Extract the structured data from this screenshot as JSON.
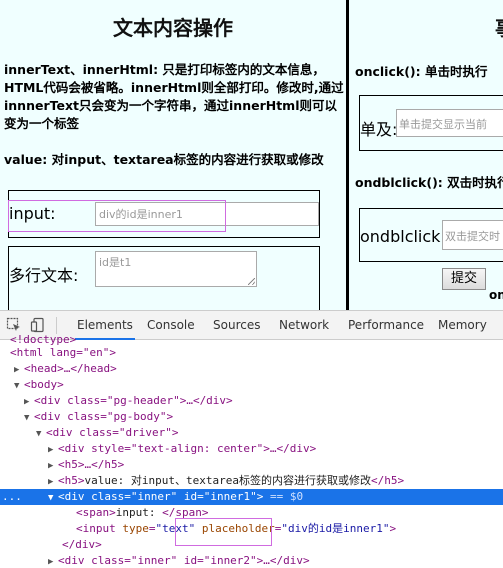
{
  "page": {
    "title": "文本内容操作",
    "para1": "innerText、innerHtml: 只是打印标签内的文本信息，HTML代码会被省略。innerHtml则全部打印。修改时,通过innnerText只会变为一个字符串，通过innerHtml则可以变为一个标签",
    "para2": "value: 对input、textarea标签的内容进行获取或修改",
    "input_label": "input:",
    "input_placeholder": "div的id是inner1",
    "textarea_label": "多行文本:",
    "textarea_placeholder": "id是t1"
  },
  "right": {
    "title_fragment": "事",
    "onclick_heading": "onclick(): 单击时执行",
    "single_label": "单及:",
    "single_placeholder": "单击提交显示当前",
    "dblclick_heading": "ondblclick(): 双击时执行",
    "dbl_label": "ondblclick:",
    "dbl_placeholder": "双击提交时",
    "submit_button": "提交",
    "cut_text": "on"
  },
  "devtools": {
    "tabs": [
      {
        "label": "Elements",
        "active": true
      },
      {
        "label": "Console",
        "active": false
      },
      {
        "label": "Sources",
        "active": false
      },
      {
        "label": "Network",
        "active": false
      },
      {
        "label": "Performance",
        "active": false
      },
      {
        "label": "Memory",
        "active": false
      }
    ],
    "dom": {
      "doctype": "<!doctype>",
      "html_open": "<html lang=\"en\">",
      "head": "<head>…</head>",
      "body_open": "<body>",
      "pg_header": "<div class=\"pg-header\">…</div>",
      "pg_body": "<div class=\"pg-body\">",
      "driver": "<div class=\"driver\">",
      "center_div": "<div style=\"text-align: center\">…</div>",
      "h5_collapsed": "<h5>…</h5>",
      "h5_value_tag_open": "<h5>",
      "h5_value_text": "value: 对input、textarea标签的内容进行获取或修改",
      "h5_value_tag_close": "</h5>",
      "sel_prefix": "...",
      "sel_tag": "<div ",
      "sel_attr1_name": "class",
      "sel_attr1_value": "\"inner\"",
      "sel_attr2_name": "id",
      "sel_attr2_value": "\"inner1\"",
      "sel_tag_end": ">",
      "sel_suffix": "== $0",
      "span_open": "<span>",
      "span_text": "input:  ",
      "span_close": "</span>",
      "input_tag": "<input ",
      "input_type_name": "type",
      "input_type_value": "\"text\"",
      "input_ph_name": "placeholder",
      "input_ph_value": "\"div的id是inner1\"",
      "input_end": ">",
      "div_close": "</div>",
      "inner2": "<div class=\"inner\" id=\"inner2\">…</div>"
    }
  }
}
